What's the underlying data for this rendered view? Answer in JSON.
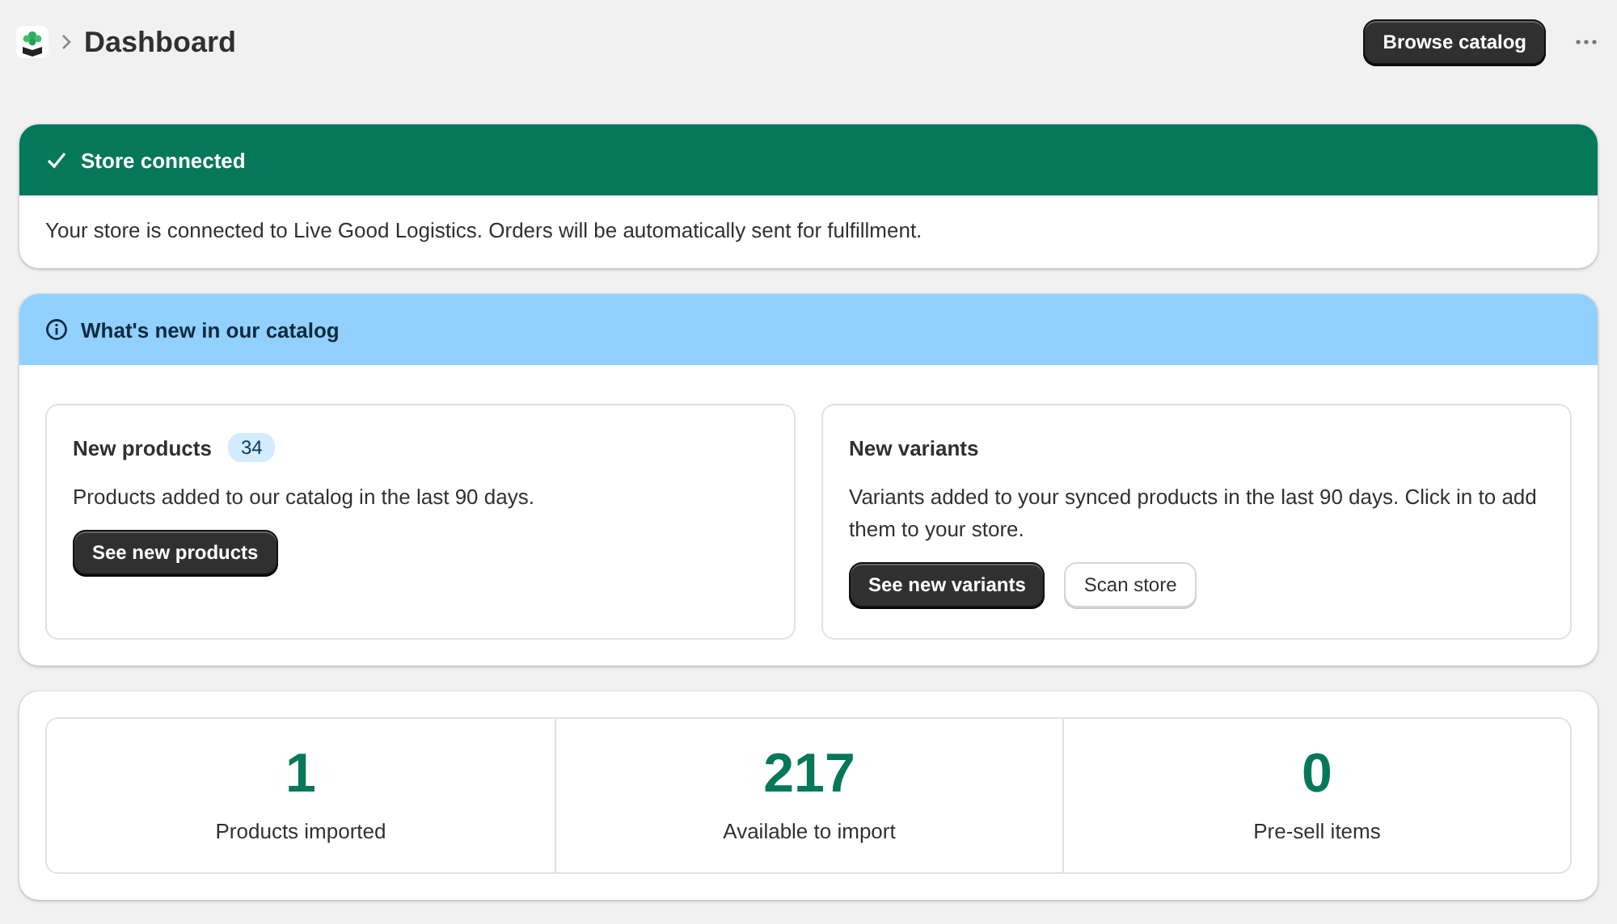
{
  "header": {
    "title": "Dashboard",
    "actions": [
      {
        "label": "Browse catalog",
        "kind": "primary"
      }
    ]
  },
  "banners": [
    {
      "kind": "success",
      "title": "Store connected",
      "text": "Your store is connected to Live Good Logistics. Orders will be automatically sent for fulfillment."
    },
    {
      "kind": "info",
      "title": "What's new in our catalog",
      "cards": [
        {
          "title": "New products",
          "badge": "34",
          "text": "Products added to our catalog in the last 90 days.",
          "buttons": [
            {
              "label": "See new products",
              "kind": "primary"
            }
          ]
        },
        {
          "title": "New variants",
          "text": "Variants added to your synced products in the last 90 days. Click in to add them to your store.",
          "buttons": [
            {
              "label": "See new variants",
              "kind": "primary"
            },
            {
              "label": "Scan store",
              "kind": "secondary"
            }
          ]
        }
      ]
    }
  ],
  "stats": [
    {
      "value": "1",
      "label": "Products imported"
    },
    {
      "value": "217",
      "label": "Available to import"
    },
    {
      "value": "0",
      "label": "Pre-sell items"
    }
  ]
}
